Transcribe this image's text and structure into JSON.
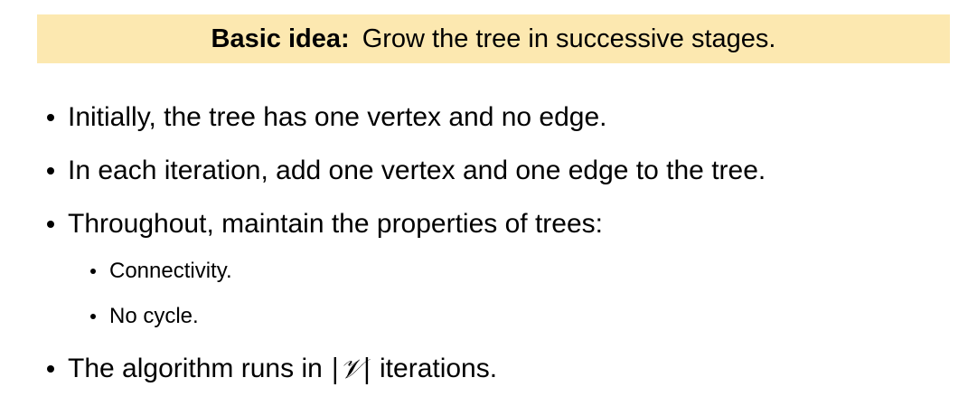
{
  "banner": {
    "label": "Basic idea:",
    "text": "Grow the tree in successive stages.",
    "background": "#fce8b0"
  },
  "bullets": {
    "b1": "Initially, the tree has one vertex and no edge.",
    "b2": "In each iteration, add one vertex and one edge to the tree.",
    "b3": "Throughout, maintain the properties of trees:",
    "b3_sub1": "Connectivity.",
    "b3_sub2": "No cycle.",
    "b4_before": "The algorithm runs in",
    "b4_math": "|𝒱|",
    "b4_after": "iterations."
  }
}
